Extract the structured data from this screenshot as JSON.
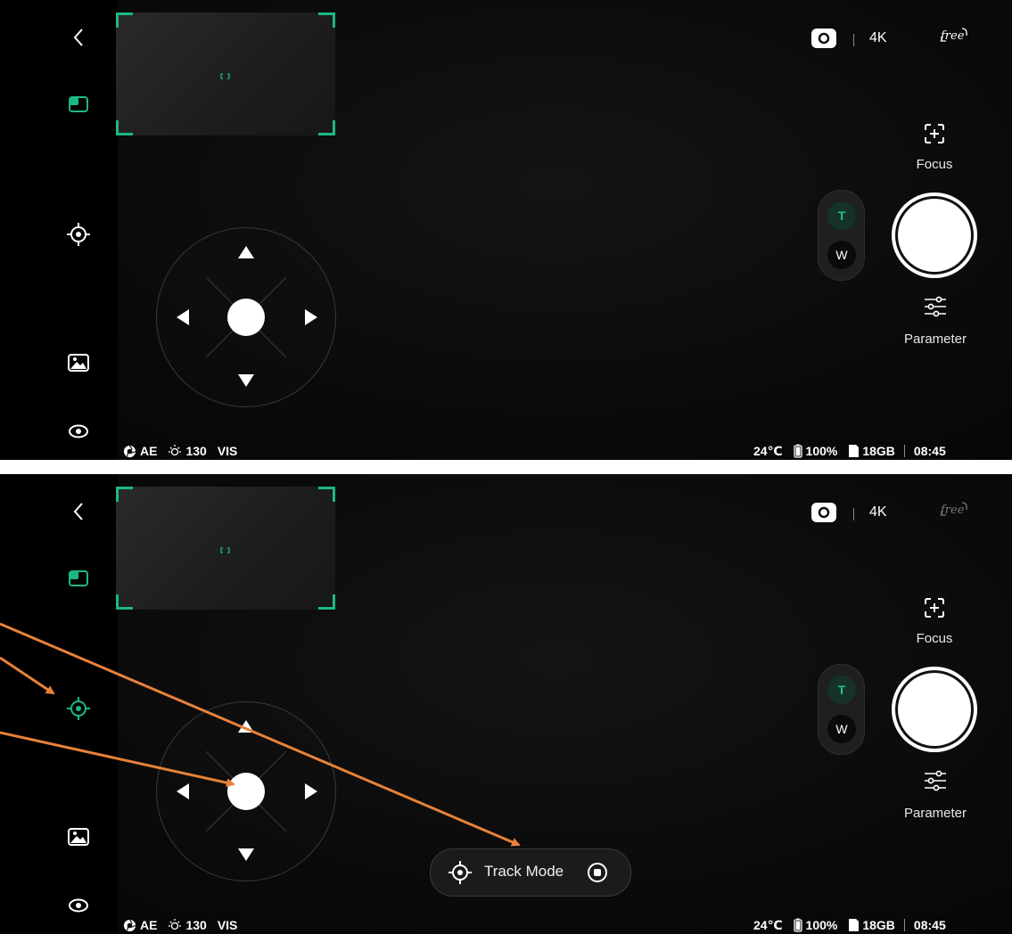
{
  "colors": {
    "accent_green": "#1bb887",
    "annotation_orange": "#e8813a",
    "panel_bg": "#0b0b0b"
  },
  "panels": [
    {
      "id": "before",
      "header": {
        "resolution": "4K",
        "free_label": "free"
      },
      "focus": {
        "label": "Focus",
        "icon": "focus-frame-icon"
      },
      "parameter": {
        "label": "Parameter",
        "icon": "sliders-icon"
      },
      "zoom": {
        "tele": "T",
        "wide": "W"
      },
      "status_left": {
        "exposure_mode": "AE",
        "iso": "130",
        "sensor": "VIS"
      },
      "status_right": {
        "temperature": "24℃",
        "battery": "100%",
        "storage": "18GB",
        "time": "08:45"
      },
      "sidebar": [
        {
          "icon": "back-chevron-icon",
          "active": false
        },
        {
          "icon": "preview-window-icon",
          "active": true
        },
        {
          "icon": "target-icon",
          "active": false
        },
        {
          "icon": "gallery-icon",
          "active": false
        },
        {
          "icon": "eye-icon",
          "active": false
        }
      ]
    },
    {
      "id": "after",
      "header": {
        "resolution": "4K",
        "free_label": "free"
      },
      "focus": {
        "label": "Focus",
        "icon": "focus-frame-icon"
      },
      "parameter": {
        "label": "Parameter",
        "icon": "sliders-icon"
      },
      "zoom": {
        "tele": "T",
        "wide": "W"
      },
      "status_left": {
        "exposure_mode": "AE",
        "iso": "130",
        "sensor": "VIS"
      },
      "status_right": {
        "temperature": "24℃",
        "battery": "100%",
        "storage": "18GB",
        "time": "08:45"
      },
      "track_mode": {
        "label": "Track Mode"
      },
      "sidebar": [
        {
          "icon": "back-chevron-icon",
          "active": false
        },
        {
          "icon": "preview-window-icon",
          "active": true
        },
        {
          "icon": "target-icon",
          "active": true
        },
        {
          "icon": "gallery-icon",
          "active": false
        },
        {
          "icon": "eye-icon",
          "active": false
        }
      ]
    }
  ]
}
